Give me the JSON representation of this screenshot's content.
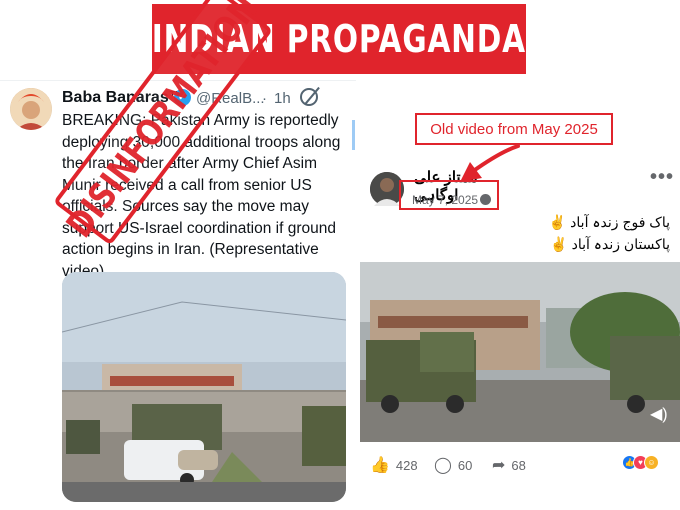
{
  "banner": {
    "title": "INDIAN PROPAGANDA"
  },
  "tweet": {
    "name": "Baba Banaras™",
    "handle": "@RealB...",
    "dot": "·",
    "time": "1h",
    "text": "BREAKING: Pakistan Army is reportedly deploying 30,000 additional troops along the Iran border after Army Chief Asim Munir received a call from senior US officials. Sources say the move may support US-Israel coordination if ground action begins in Iran. (Representative video)",
    "stamp": "DISINFORMATION"
  },
  "facebook_post": {
    "callout": "Old video from May 2025",
    "author": "ممتاز علی اوگاہی",
    "date": "May 7, 2025",
    "separator": "·",
    "caption_line1": "پاک فوج زندہ آباد ✌️",
    "caption_line2": "پاکستان زندہ آباد ✌️",
    "likes": "428",
    "comments": "60",
    "shares": "68"
  },
  "colors": {
    "accent_red": "#e0242c",
    "verified_blue": "#1d9bf0"
  }
}
